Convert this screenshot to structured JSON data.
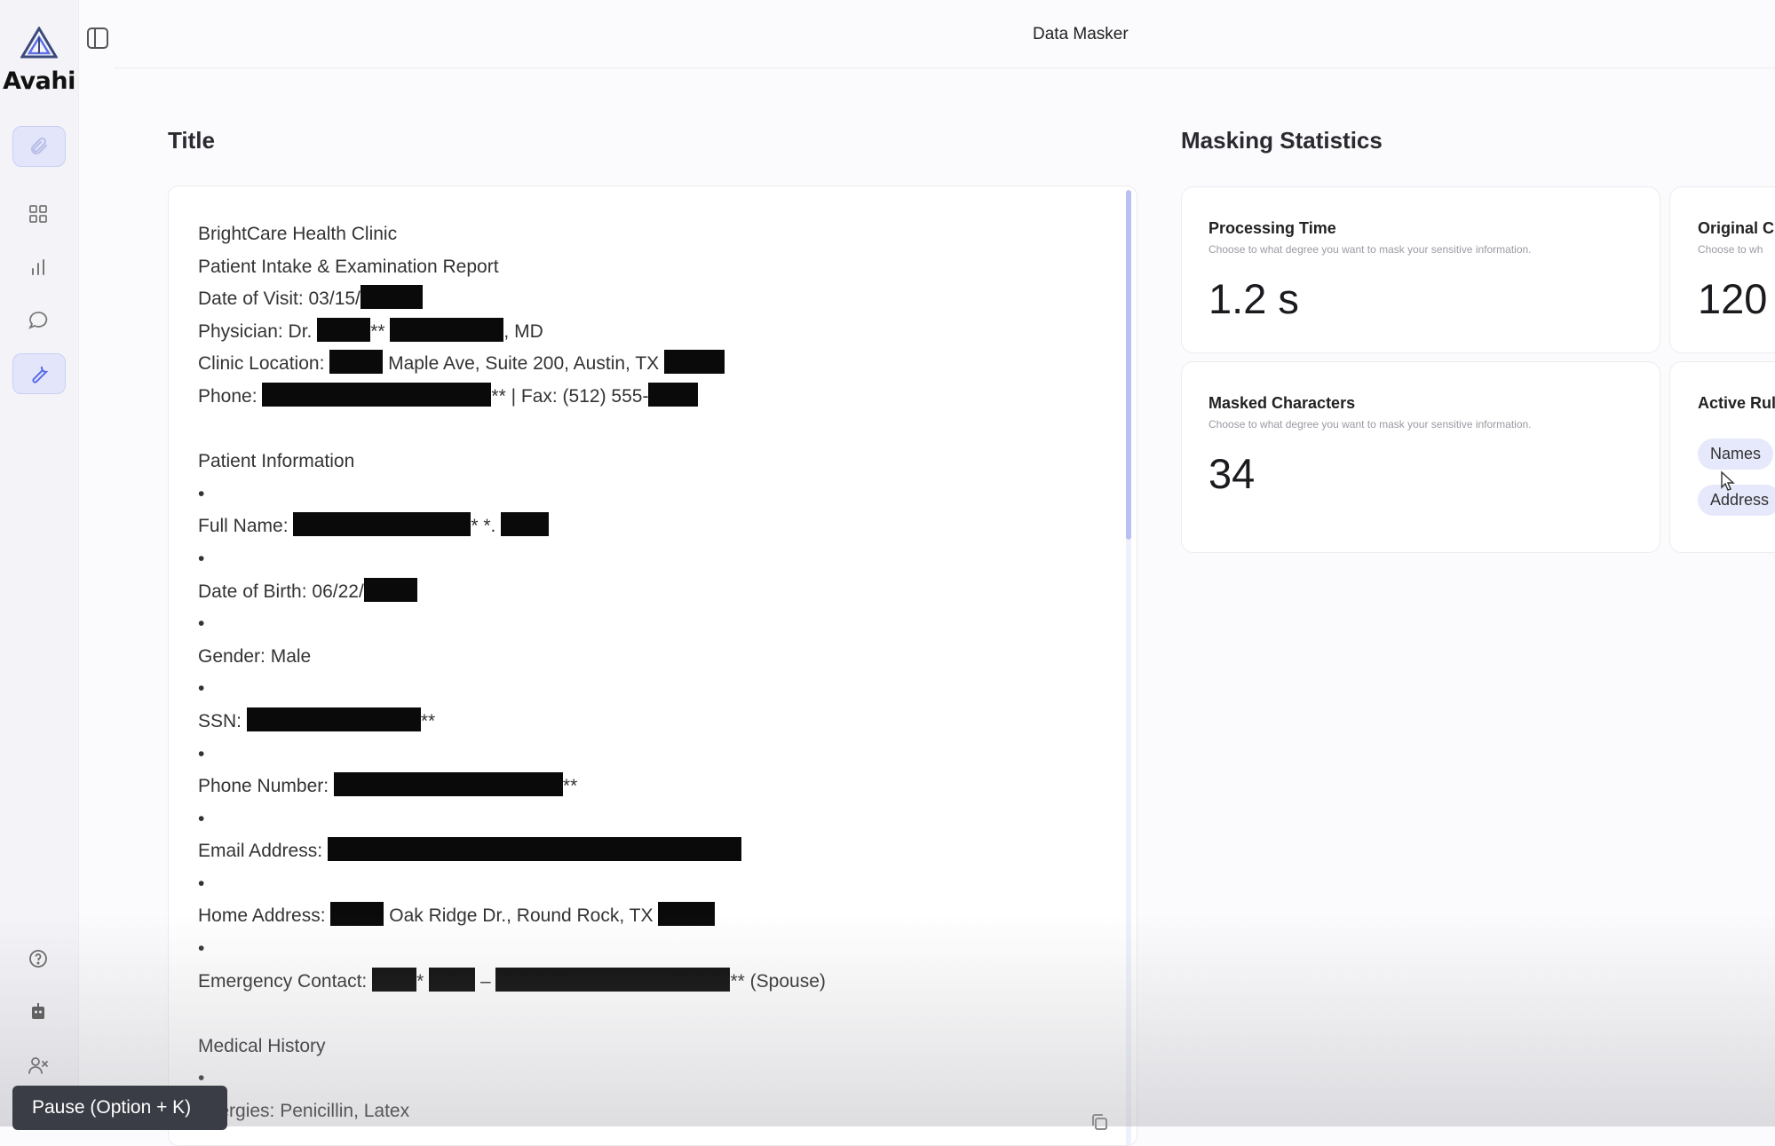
{
  "brand": {
    "name": "Avahi"
  },
  "header": {
    "title": "Data Masker"
  },
  "document": {
    "section_title": "Title",
    "lines": {
      "clinic": "BrightCare Health Clinic",
      "report": "Patient Intake & Examination Report",
      "visit_label": "Date of Visit: 03/15/",
      "physician_label": "Physician: Dr. ",
      "physician_mid": "**",
      "physician_end": ", MD",
      "location_label": "Clinic Location: ",
      "location_mid": " Maple Ave, Suite 200, Austin, TX ",
      "phone_label": "Phone: ",
      "phone_end": "** | Fax: (512) 555-",
      "patient_info": "Patient Information",
      "bullet": "•",
      "fullname_label": "Full Name: ",
      "fullname_mid": "* *.",
      "dob_label": "Date of Birth: 06/22/",
      "gender": "Gender: Male",
      "ssn_label": "SSN: ",
      "ssn_end": "**",
      "phone_number_label": "Phone Number: ",
      "phone_number_end": "**",
      "email_label": "Email Address: ",
      "home_label": "Home Address: ",
      "home_mid": " Oak Ridge Dr., Round Rock, TX ",
      "emergency_label": "Emergency Contact: ",
      "emergency_star": "*",
      "emergency_dash": " – ",
      "emergency_end": "** (Spouse)",
      "medical_history": "Medical History",
      "allergies": "Allergies: Penicillin, Latex"
    }
  },
  "stats": {
    "section_title": "Masking Statistics",
    "cards": [
      {
        "title": "Processing Time",
        "desc": "Choose to what degree you want to mask your sensitive information.",
        "value": "1.2 s"
      },
      {
        "title": "Original C",
        "desc": "Choose to wh",
        "value": "120"
      },
      {
        "title": "Masked Characters",
        "desc": "Choose to what degree you want to mask your sensitive information.",
        "value": "34"
      },
      {
        "title": "Active Rul"
      }
    ],
    "rules": [
      "Names",
      "Address"
    ]
  },
  "tooltip": {
    "text": "Pause (Option + K)"
  },
  "colors": {
    "accent": "#5b6ee8",
    "accent_light": "#e3e6fb",
    "redaction": "#0a0a0a"
  }
}
